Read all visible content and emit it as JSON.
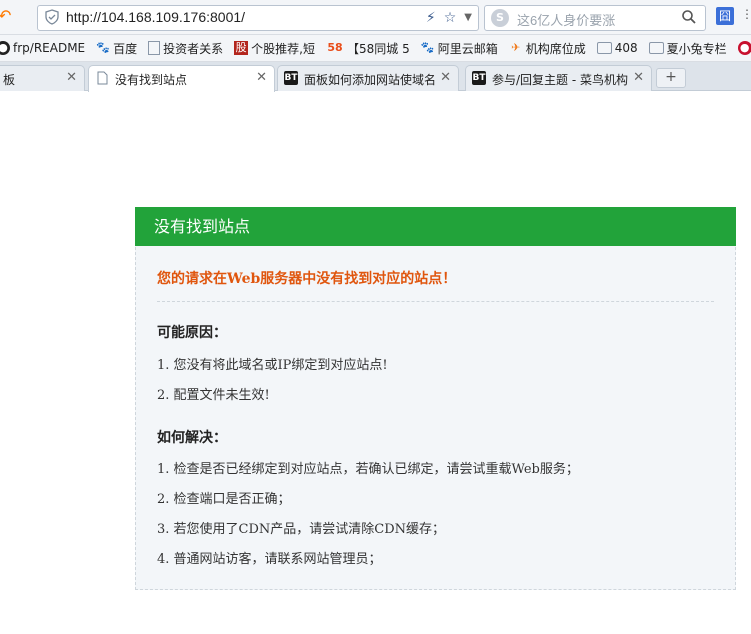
{
  "address_bar": {
    "url": "http://104.168.109.176:8001/",
    "search_placeholder": "这6亿人身价要涨",
    "search_logo": "S",
    "ext_label": "囧"
  },
  "bookmarks": [
    {
      "label": "frp/README",
      "icon": "github-icon"
    },
    {
      "label": "百度",
      "icon": "baidu-paw-icon"
    },
    {
      "label": "投资者关系",
      "icon": "page-icon"
    },
    {
      "label": "个股推荐,短",
      "icon": "stock-icon"
    },
    {
      "label": "【58同城 5",
      "icon": "58-icon"
    },
    {
      "label": "阿里云邮箱",
      "icon": "aliyun-paw-icon"
    },
    {
      "label": "机构席位成",
      "icon": "bird-icon"
    },
    {
      "label": "408",
      "icon": "folder-icon"
    },
    {
      "label": "夏小兔专栏",
      "icon": "folder-icon"
    }
  ],
  "tabs": [
    {
      "label": "板",
      "fav": ""
    },
    {
      "label": "没有找到站点",
      "fav": "page-icon"
    },
    {
      "label": "面板如何添加网站使域名",
      "fav": "BT"
    },
    {
      "label": "参与/回复主题 - 菜鸟机构",
      "fav": "BT"
    }
  ],
  "page": {
    "header": "没有找到站点",
    "error_message": "您的请求在Web服务器中没有找到对应的站点！",
    "reasons_title": "可能原因：",
    "reasons": [
      "1. 您没有将此域名或IP绑定到对应站点!",
      "2. 配置文件未生效!"
    ],
    "solutions_title": "如何解决：",
    "solutions": [
      "1. 检查是否已经绑定到对应站点，若确认已绑定，请尝试重载Web服务；",
      "2. 检查端口是否正确；",
      "3. 若您使用了CDN产品，请尝试清除CDN缓存；",
      "4. 普通网站访客，请联系网站管理员；"
    ]
  },
  "colors": {
    "header_bg": "#22a33a",
    "error_text": "#e0560e"
  }
}
